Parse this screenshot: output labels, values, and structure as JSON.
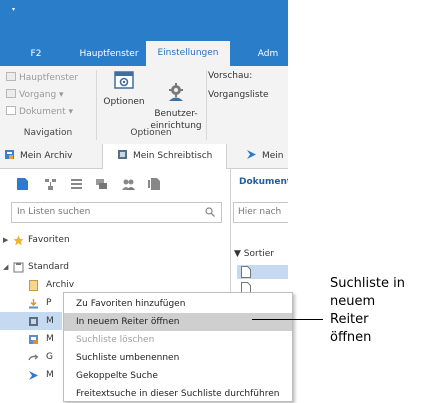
{
  "titlebar": {
    "qat_glyph": "▾",
    "tabs": [
      {
        "label": "F2"
      },
      {
        "label": "Hauptfenster"
      },
      {
        "label": "Einstellungen"
      },
      {
        "label": "Adm"
      }
    ],
    "active_tab": "Einstellungen",
    "accent_color": "#2a7dc9"
  },
  "ribbon": {
    "navigation": {
      "items": [
        {
          "label": "Hauptfenster",
          "icon": "home-icon"
        },
        {
          "label": "Vorgang ▾",
          "icon": "process-icon"
        },
        {
          "label": "Dokument ▾",
          "icon": "document-icon"
        }
      ],
      "group_label": "Navigation"
    },
    "optionen": {
      "buttons": [
        {
          "label": "Optionen",
          "icon": "options-icon"
        },
        {
          "label": "Benutzer-\neinrichtung",
          "icon": "user-settings-icon"
        }
      ],
      "group_label": "Optionen"
    },
    "vorschau": {
      "line1": "Vorschau:",
      "line2": "Vorgangsliste"
    }
  },
  "doc_tabs": [
    {
      "label": "Mein Archiv",
      "icon": "archive-icon"
    },
    {
      "label": "Mein Schreibtisch",
      "icon": "desk-icon"
    },
    {
      "label": "Mein",
      "icon": "arrow-icon"
    }
  ],
  "left_panel": {
    "toolbar_icons": [
      "document-icon",
      "hierarchy-icon",
      "list-icon",
      "folders-icon",
      "users-icon",
      "documents-icon"
    ],
    "search": {
      "placeholder": "In Listen suchen"
    },
    "tree": [
      {
        "label": "Favoriten",
        "icon": "star-icon",
        "expanded": false
      },
      {
        "label": "Standard",
        "icon": "standard-icon",
        "expanded": true
      },
      {
        "label": "Archiv",
        "icon": "archive-icon"
      },
      {
        "label": "P",
        "icon": "download-icon"
      },
      {
        "label": "M",
        "icon": "desk-icon"
      },
      {
        "label": "M",
        "icon": "folder-icon"
      },
      {
        "label": "G",
        "icon": "link-icon"
      },
      {
        "label": "M",
        "icon": "arrow-icon"
      }
    ]
  },
  "right_panel": {
    "header": "Dokument",
    "search_placeholder": "Hier nach",
    "sort_label": "▼ Sortier"
  },
  "context_menu": {
    "items": [
      {
        "label": "Zu Favoriten hinzufügen",
        "disabled": false,
        "hover": false
      },
      {
        "label": "In neuem Reiter öffnen",
        "disabled": false,
        "hover": true
      },
      {
        "label": "Suchliste löschen",
        "disabled": true,
        "hover": false
      },
      {
        "label": "Suchliste umbenennen",
        "disabled": false,
        "hover": false
      },
      {
        "label": "Gekoppelte Suche",
        "disabled": false,
        "hover": false
      },
      {
        "label": "Freitextsuche in dieser Suchliste durchführen",
        "disabled": false,
        "hover": false
      }
    ]
  },
  "annotation": {
    "text": "Suchliste in\nneuem\nReiter\nöffnen"
  }
}
